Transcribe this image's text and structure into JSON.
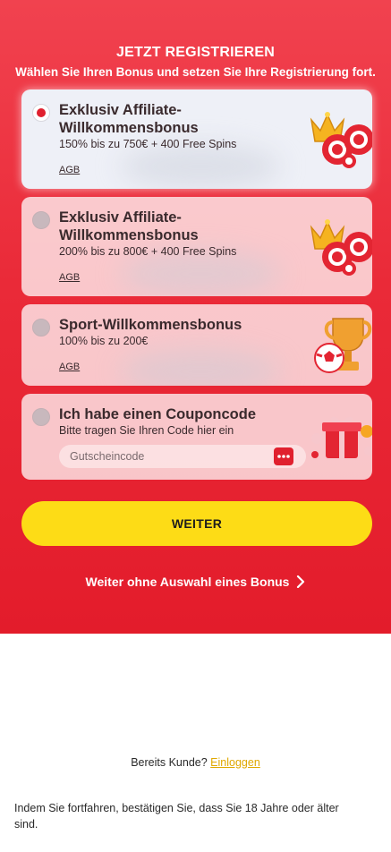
{
  "header": {
    "title": "JETZT REGISTRIEREN",
    "subtitle": "Wählen Sie Ihren Bonus und setzen Sie Ihre Registrierung fort."
  },
  "bonuses": [
    {
      "title": "Exklusiv Affiliate-Willkommensbonus",
      "desc": "150% bis zu 750€ + 400 Free Spins",
      "agb": "AGB",
      "selected": true,
      "icon": "crown-chips-icon"
    },
    {
      "title": "Exklusiv Affiliate-Willkommensbonus",
      "desc": "200% bis zu 800€ + 400 Free Spins",
      "agb": "AGB",
      "selected": false,
      "icon": "crown-chips-icon"
    },
    {
      "title": "Sport-Willkommensbonus",
      "desc": "100% bis zu 200€",
      "agb": "AGB",
      "selected": false,
      "icon": "trophy-ball-icon"
    }
  ],
  "coupon": {
    "title": "Ich habe einen Couponcode",
    "desc": "Bitte tragen Sie Ihren Code hier ein",
    "placeholder": "Gutscheincode",
    "value": "",
    "icon": "gift-icon"
  },
  "actions": {
    "continue_label": "WEITER",
    "skip_label": "Weiter ohne Auswahl eines Bonus"
  },
  "footer": {
    "already_customer": "Bereits Kunde?",
    "login_label": "Einloggen",
    "legal": "Indem Sie fortfahren, bestätigen Sie, dass Sie 18 Jahre oder älter sind."
  },
  "colors": {
    "brand_red": "#e31c2b",
    "button_yellow": "#fddc16",
    "login_link": "#e0a800"
  }
}
